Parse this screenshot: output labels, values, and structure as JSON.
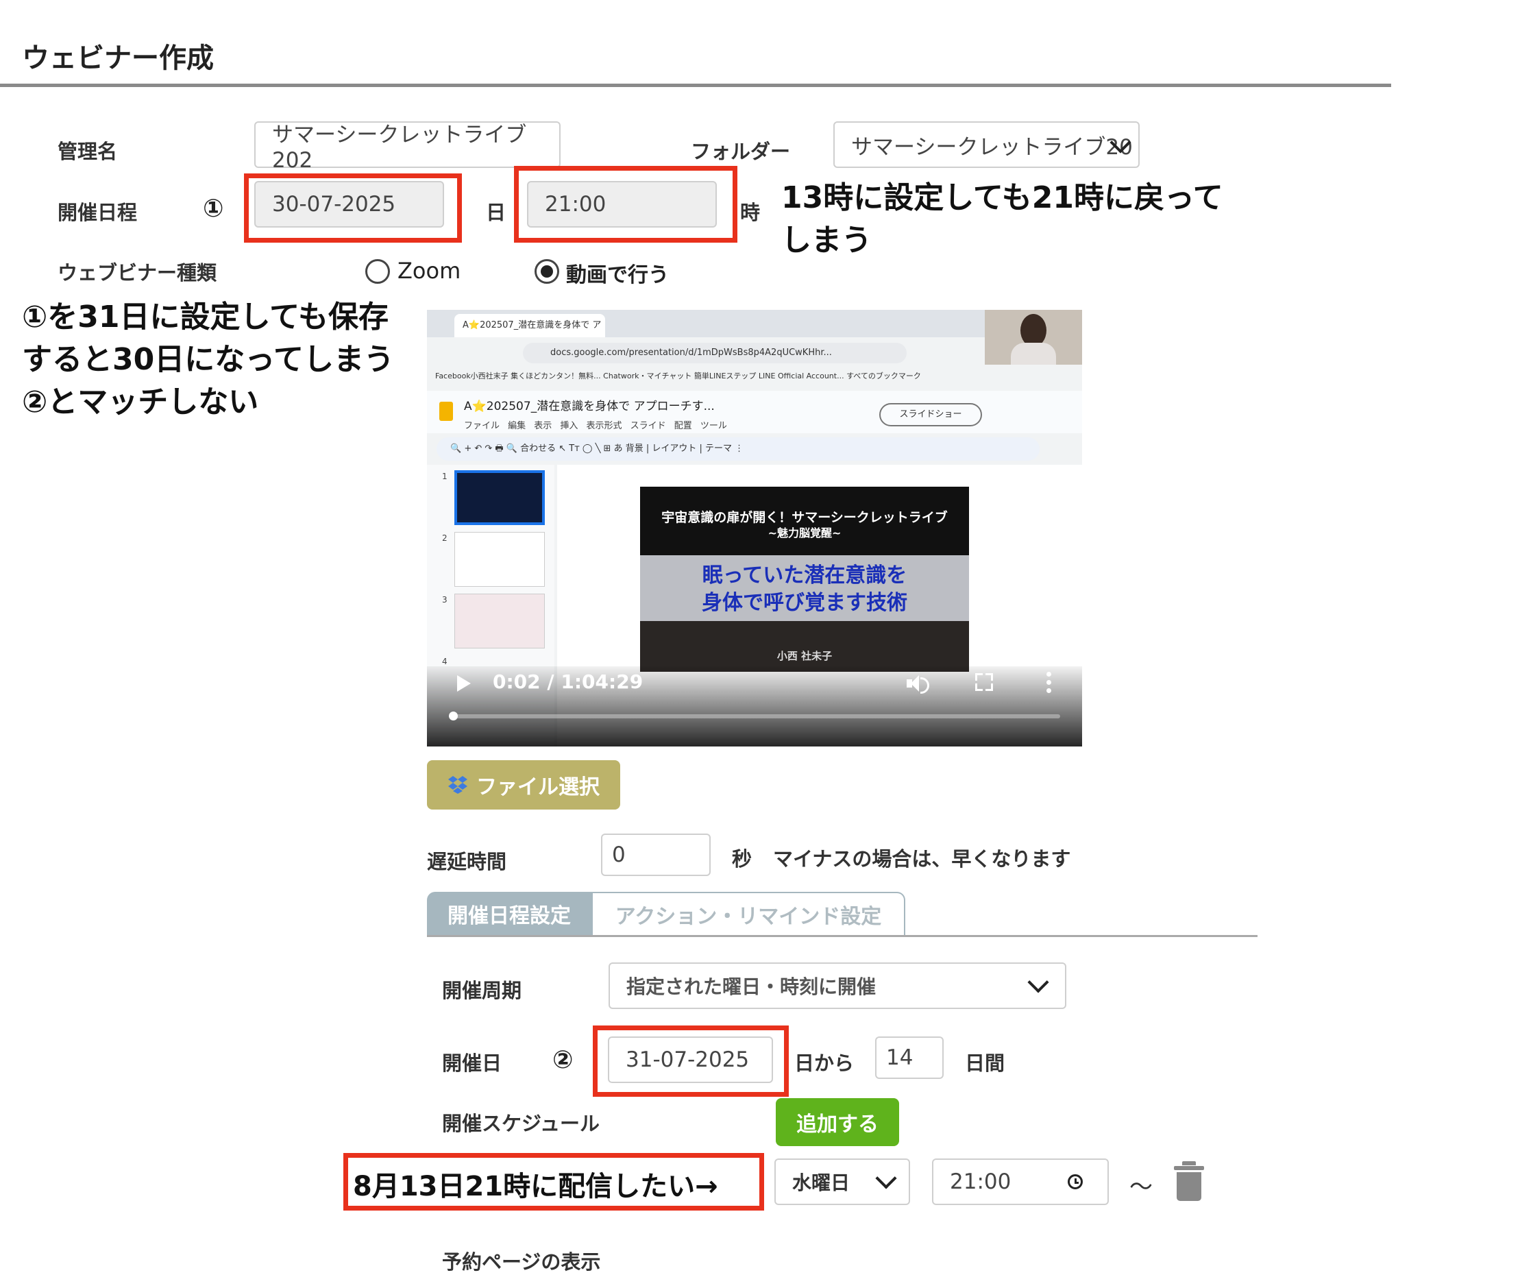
{
  "page": {
    "title": "ウェビナー作成"
  },
  "form": {
    "admin_name_label": "管理名",
    "admin_name_value": "サマーシークレットライブ202",
    "folder_label": "フォルダー",
    "folder_value": "サマーシークレットライブ20",
    "schedule_label": "開催日程",
    "circle1": "①",
    "date_value": "30-07-2025",
    "day_unit": "日",
    "time_value": "21:00",
    "hour_unit": "時",
    "webinar_type_label": "ウェブビナー種類",
    "radio_zoom": "Zoom",
    "radio_video": "動画で行う",
    "radio_selected": "動画で行う",
    "delay_label": "遅延時間",
    "delay_value": "0",
    "delay_unit": "秒",
    "delay_note": "マイナスの場合は、早くなります"
  },
  "annotations": {
    "time_note_line1": "13時に設定しても21時に戻って",
    "time_note_line2": "しまう",
    "left_note_line1": "①を31日に設定しても保存",
    "left_note_line2": "すると30日になってしまう",
    "left_note_line3": "②とマッチしない",
    "bottom_note": "8月13日21時に配信したい→"
  },
  "video": {
    "current_time": "0:02",
    "duration": "1:04:29",
    "time_display": "0:02 / 1:04:29",
    "progress": 0.003,
    "browser_tab": "A⭐202507_潜在意識を身体で ア",
    "url": "docs.google.com/presentation/d/1mDpWsBs8p4A2qUCwKHhr...",
    "bookmarks": "Facebook小西社末子   集くほどカンタン！無料...   Chatwork・マイチャット   簡単LINEステップ   LINE Official Account...      すべてのブックマーク",
    "doc_title": "A⭐202507_潜在意識を身体で アプローチす...",
    "doc_menu": "ファイル 編集 表示 挿入 表示形式 スライド 配置 ツール",
    "slideshow_label": "スライドショー",
    "toolbar_text": "🔍 +  ↶ ↷ 🖶  🔍 合わせる  ↖ Tт ◯ ╲ ⊞  あ  背景 | レイアウト | テーマ  ⋮",
    "slide_title1": "宇宙意識の扉が開く！サマーシークレットライブ",
    "slide_title2": "~魅力脳覚醒~",
    "slide_main_line1": "眠っていた潜在意識を",
    "slide_main_line2": "身体で呼び覚ます技術",
    "slide_author": "小西 社未子",
    "thumb_numbers": [
      "1",
      "2",
      "3",
      "4"
    ]
  },
  "buttons": {
    "file_select": "ファイル選択",
    "add": "追加する"
  },
  "tabs": {
    "active": "開催日程設定",
    "inactive": "アクション・リマインド設定"
  },
  "schedule": {
    "cycle_label": "開催周期",
    "cycle_value": "指定された曜日・時刻に開催",
    "date_label": "開催日",
    "circle2": "②",
    "start_date": "31-07-2025",
    "from_suffix": "日から",
    "days_value": "14",
    "days_suffix": "日間",
    "schedule_label": "開催スケジュール",
    "weekday_value": "水曜日",
    "time_value": "21:00",
    "tilde": "〜",
    "reservation_label": "予約ページの表示"
  },
  "colors": {
    "highlight_red": "#e8311c",
    "file_button": "#bcb36a",
    "add_button": "#5fb31c",
    "active_tab": "#a6b7bf"
  }
}
